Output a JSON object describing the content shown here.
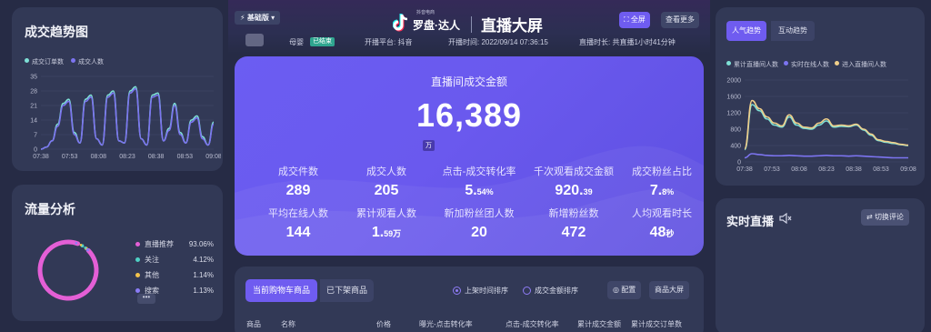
{
  "colors": {
    "accent": "#6f5cf0",
    "panel": "#323956",
    "background": "#262b45",
    "trend_orders": "#7ee0d6",
    "trend_people": "#7c74f0"
  },
  "trend": {
    "title": "成交趋势图",
    "legend": [
      "成交订单数",
      "成交人数"
    ]
  },
  "traffic": {
    "title": "流量分析",
    "items": [
      {
        "label": "直播推荐",
        "value": "93.06%",
        "color": "#e45fd6"
      },
      {
        "label": "关注",
        "value": "4.12%",
        "color": "#4fd1c5"
      },
      {
        "label": "其他",
        "value": "1.14%",
        "color": "#f3c34b"
      },
      {
        "label": "搜索",
        "value": "1.13%",
        "color": "#8a7cf5"
      }
    ],
    "more_label": "•••"
  },
  "header": {
    "version_label": "基础版",
    "brand_small": "抖音电商",
    "brand": "罗盘·达人",
    "title": "直播大屏",
    "fullscreen_label": "全屏",
    "viewmore_label": "查看更多",
    "anchor_name": "母婴",
    "status_badge": "已结束",
    "platform": "开播平台: 抖音",
    "start_time": "开播时间: 2022/09/14 07:36:15",
    "duration": "直播时长: 共直播1小时41分钟"
  },
  "gmv": {
    "title": "直播间成交金额",
    "value": "16,389",
    "unit": "万",
    "metrics": [
      {
        "label": "成交件数",
        "value": "289",
        "unit": ""
      },
      {
        "label": "成交人数",
        "value": "205",
        "unit": ""
      },
      {
        "label": "点击-成交转化率",
        "value": "5.",
        "unit": "54%"
      },
      {
        "label": "千次观看成交金额",
        "value": "920.",
        "unit": "39"
      },
      {
        "label": "成交粉丝占比",
        "value": "7.",
        "unit": "8%"
      },
      {
        "label": "平均在线人数",
        "value": "144",
        "unit": ""
      },
      {
        "label": "累计观看人数",
        "value": "1.",
        "unit": "59万"
      },
      {
        "label": "新加粉丝团人数",
        "value": "20",
        "unit": ""
      },
      {
        "label": "新增粉丝数",
        "value": "472",
        "unit": ""
      },
      {
        "label": "人均观看时长",
        "value": "48",
        "unit": "秒"
      }
    ]
  },
  "products": {
    "tab_cart": "当前购物车商品",
    "tab_off": "已下架商品",
    "sort_time": "上架时间排序",
    "sort_amount": "成交金额排序",
    "config_label": "配置",
    "bigscreen_label": "商品大屏",
    "columns": [
      "商品",
      "名称",
      "价格",
      "曝光-点击转化率",
      "点击-成交转化率",
      "累计成交金额",
      "累计成交订单数"
    ]
  },
  "popularity": {
    "tab_pop": "人气趋势",
    "tab_interact": "互动趋势",
    "legend": [
      {
        "label": "累计直播间人数",
        "color": "#7ee0d6"
      },
      {
        "label": "实时在线人数",
        "color": "#7c74f0"
      },
      {
        "label": "进入直播间人数",
        "color": "#f0cf8a"
      }
    ]
  },
  "live": {
    "title": "实时直播",
    "switch_label": "切换评论"
  },
  "chart_data": [
    {
      "type": "line",
      "title": "成交趋势图",
      "x": [
        "07:38",
        "07:53",
        "08:08",
        "08:23",
        "08:38",
        "08:53",
        "09:08"
      ],
      "ylim": [
        0,
        35
      ],
      "yticks": [
        0,
        7,
        14,
        21,
        28,
        35
      ],
      "series": [
        {
          "name": "成交订单数",
          "values": [
            0,
            1,
            4,
            12,
            22,
            24,
            8,
            3,
            24,
            26,
            5,
            2,
            26,
            28,
            4,
            3,
            28,
            30,
            5,
            2,
            26,
            27,
            4,
            10,
            22,
            8,
            3,
            14,
            16,
            6,
            2,
            13
          ]
        },
        {
          "name": "成交人数",
          "values": [
            0,
            1,
            4,
            11,
            21,
            23,
            7,
            3,
            23,
            25,
            5,
            2,
            25,
            27,
            4,
            3,
            27,
            29,
            5,
            2,
            25,
            26,
            4,
            9,
            21,
            7,
            3,
            13,
            15,
            5,
            2,
            12
          ]
        }
      ]
    },
    {
      "type": "pie",
      "title": "流量分析",
      "categories": [
        "直播推荐",
        "关注",
        "其他",
        "搜索"
      ],
      "values": [
        93.06,
        4.12,
        1.14,
        1.13
      ]
    },
    {
      "type": "line",
      "title": "人气趋势",
      "x": [
        "07:38",
        "07:53",
        "08:08",
        "08:23",
        "08:38",
        "08:53",
        "09:08"
      ],
      "ylim": [
        0,
        2000
      ],
      "yticks": [
        0,
        400,
        800,
        1200,
        1600,
        2000
      ],
      "series": [
        {
          "name": "累计直播间人数",
          "values": [
            300,
            1400,
            1250,
            1050,
            900,
            850,
            1100,
            900,
            820,
            800,
            900,
            1000,
            850,
            870,
            860,
            900,
            780,
            650,
            520,
            480,
            450,
            420,
            400
          ]
        },
        {
          "name": "实时在线人数",
          "values": [
            100,
            200,
            180,
            160,
            150,
            150,
            160,
            150,
            140,
            140,
            150,
            160,
            150,
            150,
            140,
            150,
            140,
            130,
            120,
            110,
            100,
            100,
            100
          ]
        },
        {
          "name": "进入直播间人数",
          "values": [
            320,
            1500,
            1300,
            1100,
            950,
            880,
            1150,
            950,
            850,
            830,
            950,
            1050,
            880,
            900,
            880,
            920,
            800,
            680,
            540,
            500,
            470,
            430,
            410
          ]
        }
      ]
    }
  ]
}
